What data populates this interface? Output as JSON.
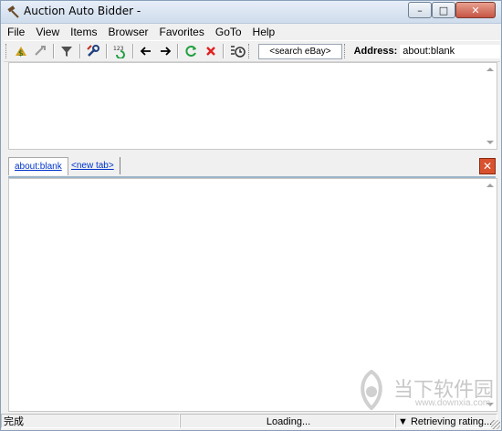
{
  "window": {
    "title": "Auction Auto Bidder -",
    "minimize_glyph": "–",
    "maximize_glyph": "□",
    "close_glyph": "✕"
  },
  "menu": [
    "File",
    "View",
    "Items",
    "Browser",
    "Favorites",
    "GoTo",
    "Help"
  ],
  "toolbar": {
    "search_placeholder": "<search eBay>",
    "address_label": "Address:",
    "address_value": "about:blank",
    "icons": [
      "bid-icon",
      "snipe-icon",
      "filter-icon",
      "tools-icon",
      "refresh-list-icon",
      "back-icon",
      "forward-icon",
      "reload-icon",
      "stop-icon",
      "schedule-icon"
    ]
  },
  "tabs": [
    {
      "label": "about:blank",
      "active": true
    },
    {
      "label": "<new tab>",
      "active": false
    }
  ],
  "status": {
    "left": "完成",
    "middle": "Loading...",
    "right": "Retrieving rating..."
  },
  "watermark": {
    "text": "当下软件园",
    "url": "www.downxia.com"
  },
  "colors": {
    "tab_link": "#0033cc",
    "close_tab": "#d9522f",
    "stop": "#e02020",
    "reload": "#20a040"
  }
}
